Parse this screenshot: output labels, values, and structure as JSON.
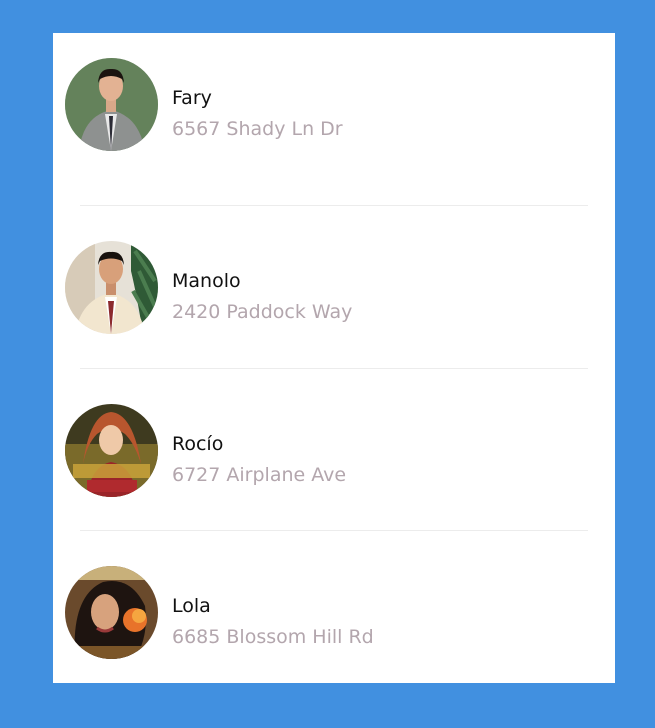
{
  "colors": {
    "background": "#4190e0",
    "card": "#ffffff",
    "name_text": "#111111",
    "address_text": "#b3a6ad",
    "divider": "#ececec"
  },
  "contacts": [
    {
      "name": "Fary",
      "address": "6567 Shady Ln Dr",
      "avatar_icon": "person-photo-avatar"
    },
    {
      "name": "Manolo",
      "address": "2420 Paddock Way",
      "avatar_icon": "person-photo-avatar"
    },
    {
      "name": "Rocío",
      "address": "6727 Airplane Ave",
      "avatar_icon": "person-photo-avatar"
    },
    {
      "name": "Lola",
      "address": "6685 Blossom Hill Rd",
      "avatar_icon": "person-photo-avatar"
    }
  ]
}
